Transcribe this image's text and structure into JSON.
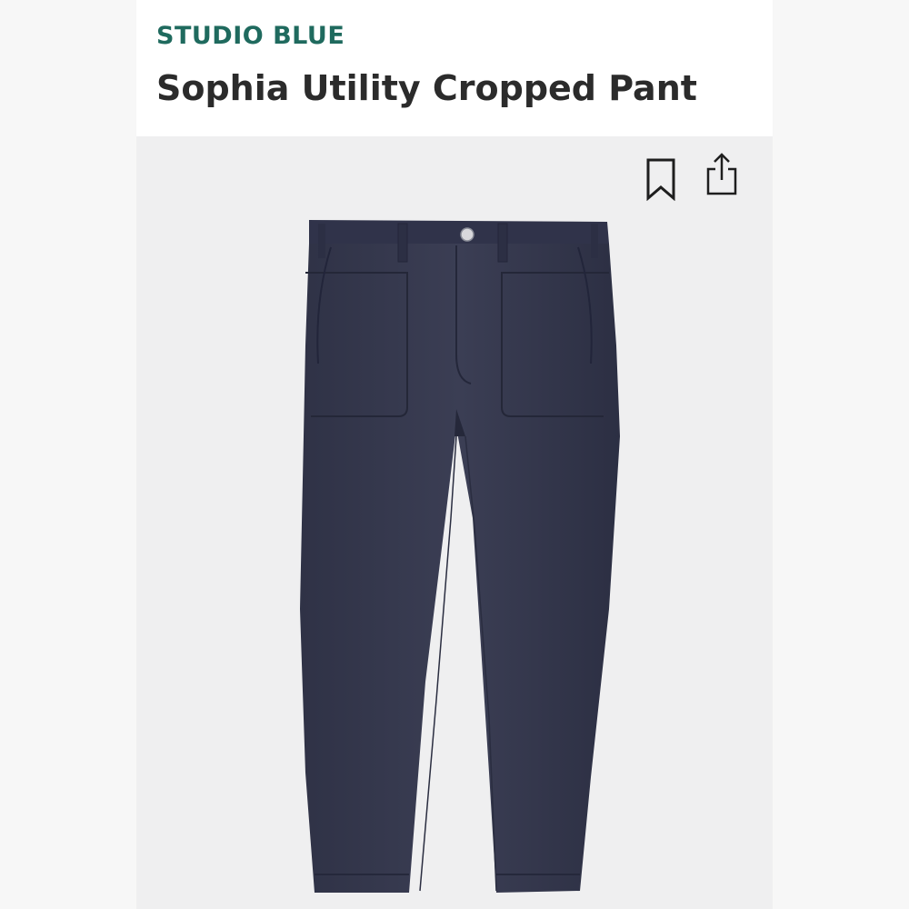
{
  "product": {
    "brand": "STUDIO BLUE",
    "title": "Sophia Utility Cropped Pant"
  },
  "colors": {
    "brand_accent": "#1f6a5e",
    "title_text": "#2b2b2b",
    "image_background": "#efeff0",
    "garment": "#3a3d52"
  },
  "actions": {
    "bookmark_icon": "bookmark-icon",
    "share_icon": "share-icon"
  }
}
